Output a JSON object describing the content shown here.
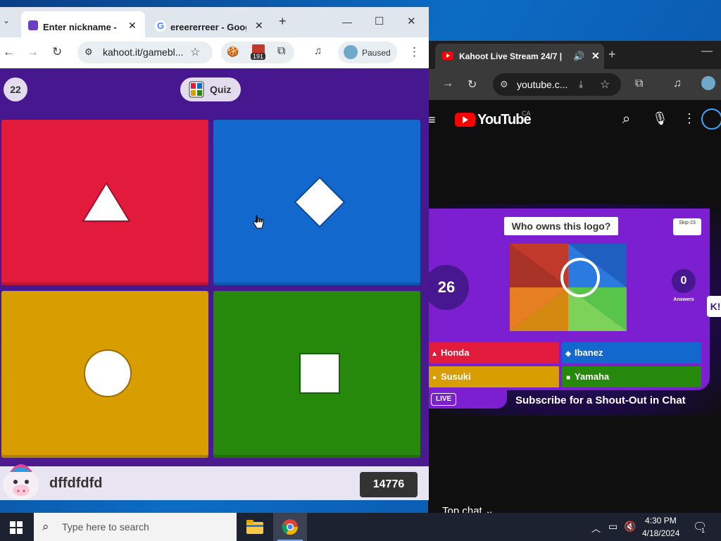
{
  "kahoot_window": {
    "tabs": [
      {
        "title": "Enter nickname - Ka",
        "active": true
      },
      {
        "title": "ereererreer - Googl",
        "active": false
      }
    ],
    "new_tab": "+",
    "controls": {
      "minimize": "—",
      "maximize": "☐",
      "close": "✕"
    },
    "url": "kahoot.it/gamebl...",
    "extension_badge": "191",
    "profile_status": "Paused"
  },
  "game": {
    "question_number": "22",
    "quiz_label": "Quiz",
    "answers": [
      {
        "shape": "triangle",
        "color": "#e21b3c"
      },
      {
        "shape": "diamond",
        "color": "#1368ce"
      },
      {
        "shape": "circle",
        "color": "#d89e00"
      },
      {
        "shape": "square",
        "color": "#26890c"
      }
    ],
    "nickname": "dffdfdfd",
    "score": "14776"
  },
  "youtube_window": {
    "tab_title": "Kahoot Live Stream 24/7 |",
    "url": "youtube.c...",
    "logo_text": "YouTube",
    "region": "CA",
    "stream": {
      "question": "Who owns this logo?",
      "skip": "Skip-23",
      "timer": "26",
      "answer_count": "0",
      "answer_count_label": "Answers",
      "options": [
        {
          "label": "Honda",
          "color": "#e21b3c"
        },
        {
          "label": "Ibanez",
          "color": "#1368ce"
        },
        {
          "label": "Susuki",
          "color": "#d89e00"
        },
        {
          "label": "Yamaha",
          "color": "#26890c"
        }
      ],
      "live_label": "LIVE",
      "banner": "Subscribe for a Shout-Out in Chat",
      "side_badge": "K!"
    },
    "chat_label": "Top chat"
  },
  "taskbar": {
    "search_placeholder": "Type here to search",
    "time": "4:30 PM",
    "date": "4/18/2024",
    "notification_count": "1"
  }
}
